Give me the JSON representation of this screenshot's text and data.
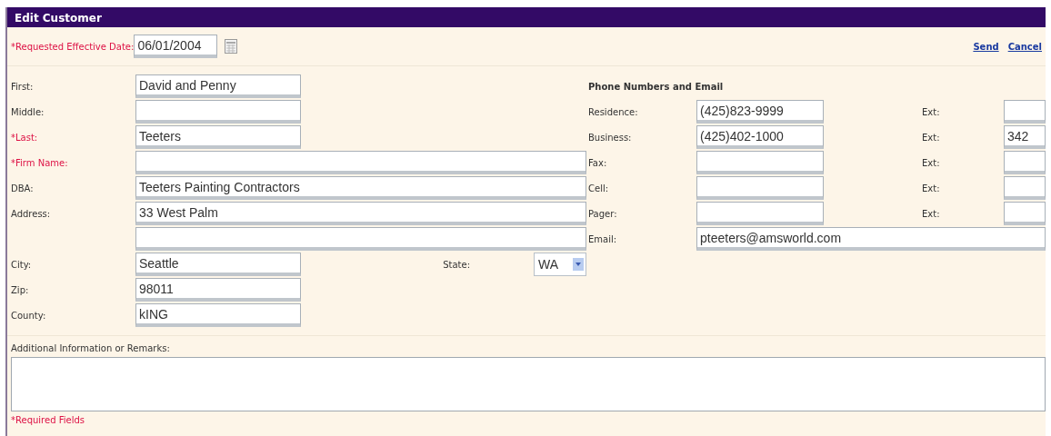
{
  "window": {
    "title": "Edit Customer"
  },
  "effective_date": {
    "label": "*Requested Effective Date:",
    "value": "06/01/2004",
    "required": true
  },
  "actions": [
    {
      "label": "Send"
    },
    {
      "label": "Cancel"
    }
  ],
  "name_fields": [
    {
      "label": "First:",
      "value": "David and Penny",
      "required": false,
      "kind": "short"
    },
    {
      "label": "Middle:",
      "required": false,
      "kind": "short"
    },
    {
      "label": "*Last:",
      "value": "Teeters",
      "required": true,
      "kind": "short"
    },
    {
      "label": "*Firm Name:",
      "required": true,
      "kind": "long"
    },
    {
      "label": "DBA:",
      "value": "Teeters Painting Contractors",
      "required": false,
      "kind": "long"
    },
    {
      "label": "Address:",
      "value": "33 West Palm",
      "required": false,
      "kind": "long"
    },
    {
      "kind": "long"
    },
    {
      "label": "City:",
      "value": "Seattle",
      "required": false,
      "kind": "short",
      "select": {
        "label": "State:",
        "value": "WA"
      }
    },
    {
      "label": "Zip:",
      "value": "98011",
      "required": false,
      "kind": "short"
    },
    {
      "label": "County:",
      "value": "kING",
      "required": false,
      "kind": "short"
    }
  ],
  "contact": {
    "heading": "Phone Numbers and Email",
    "phones": [
      {
        "label": "Residence:",
        "value": "(425)823-9999",
        "ext_label": "Ext:"
      },
      {
        "label": "Business:",
        "value": "(425)402-1000",
        "ext_label": "Ext:",
        "ext_value": "342"
      },
      {
        "label": "Fax:",
        "ext_label": "Ext:"
      },
      {
        "label": "Cell:",
        "ext_label": "Ext:"
      },
      {
        "label": "Pager:",
        "ext_label": "Ext:"
      }
    ],
    "email": {
      "label": "Email:",
      "value": "pteeters@amsworld.com"
    }
  },
  "remarks": {
    "label": "Additional Information or Remarks:"
  },
  "required_note": "*Required Fields"
}
